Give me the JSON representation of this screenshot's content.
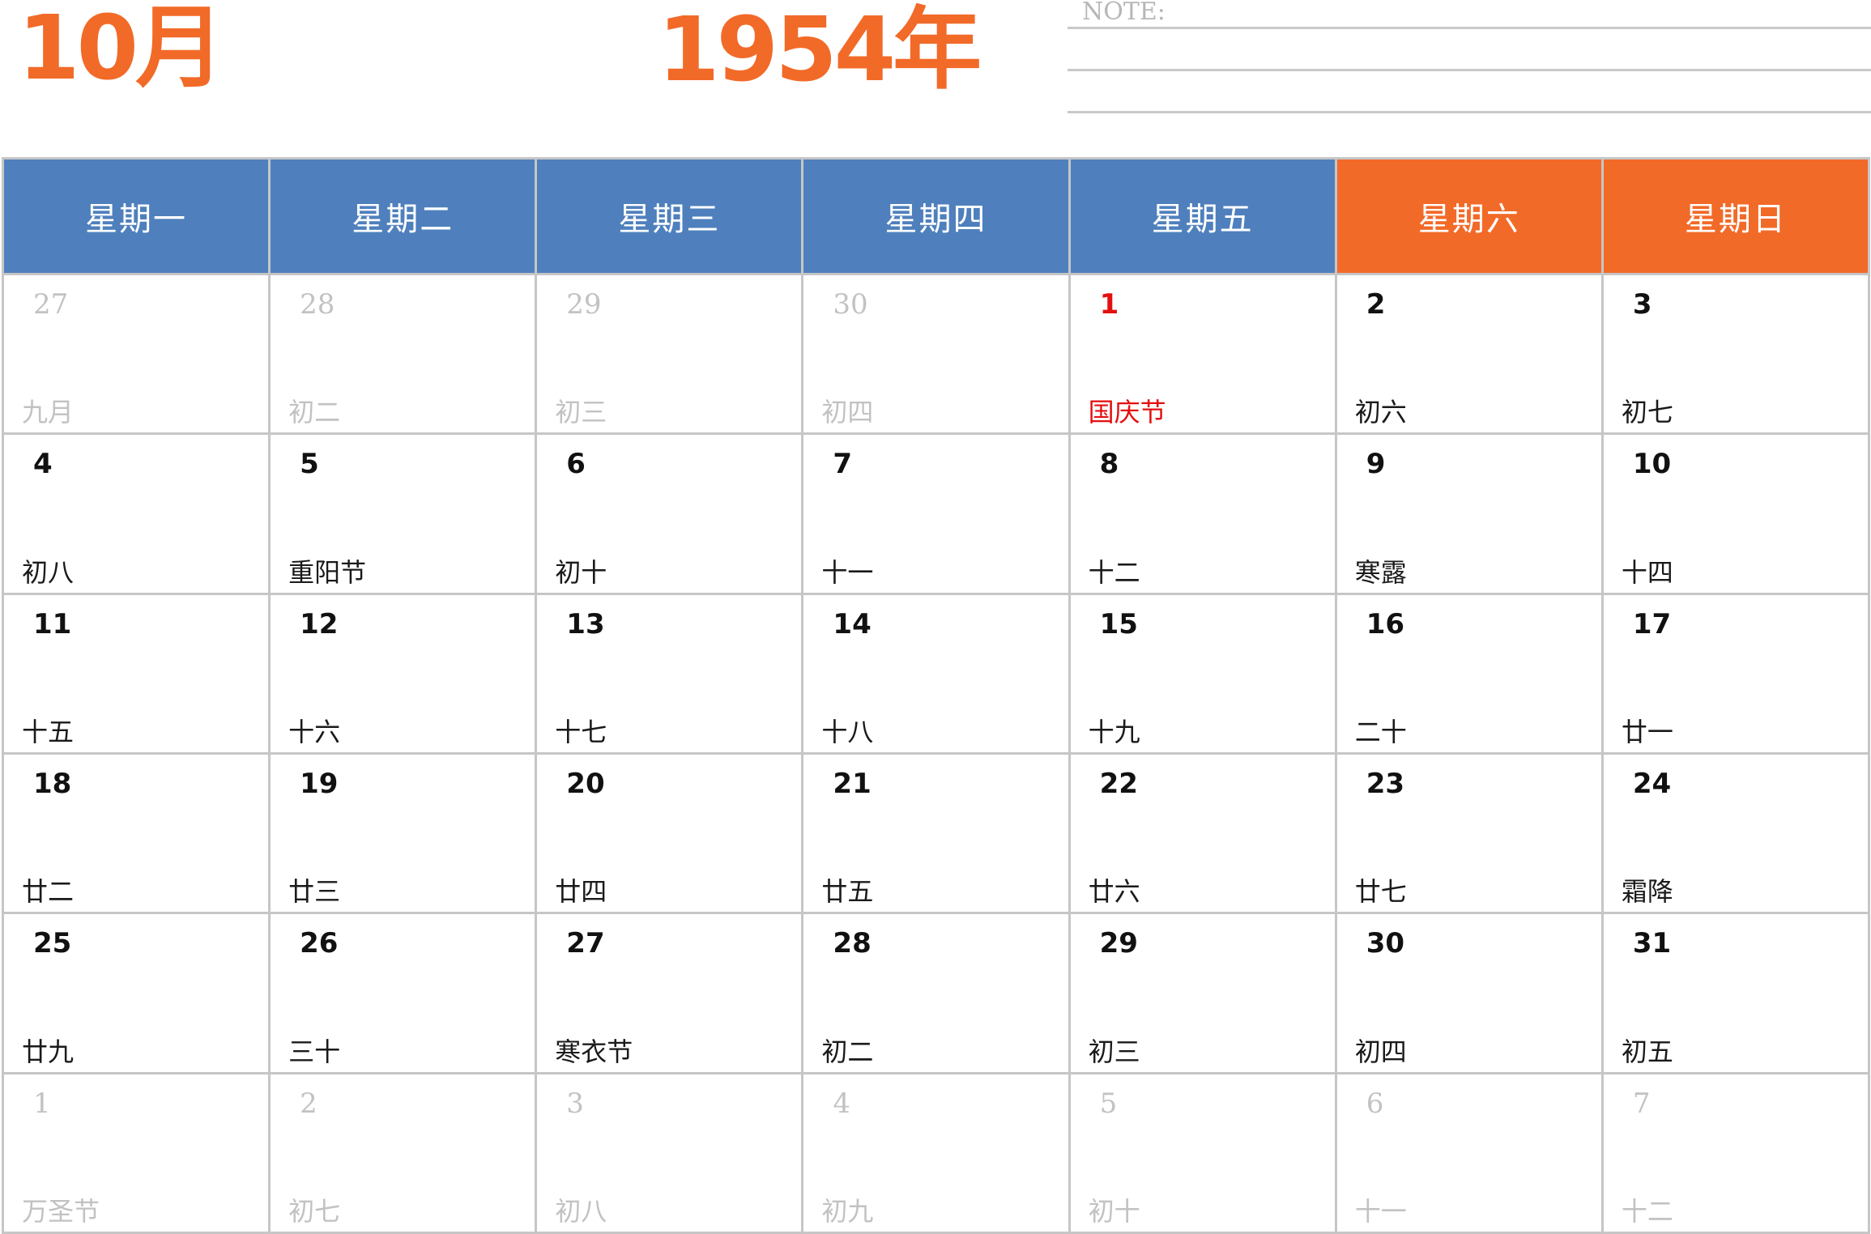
{
  "header": {
    "month": "10月",
    "year": "1954年",
    "note_label": "NOTE:"
  },
  "colors": {
    "accent": "#f26a28",
    "weekday_header": "#4f80bd",
    "holiday": "#e40f0f",
    "muted": "#c2c2c2"
  },
  "weekdays": [
    "星期一",
    "星期二",
    "星期三",
    "星期四",
    "星期五",
    "星期六",
    "星期日"
  ],
  "weeks": [
    [
      {
        "day": "27",
        "lunar": "九月",
        "muted": true
      },
      {
        "day": "28",
        "lunar": "初二",
        "muted": true
      },
      {
        "day": "29",
        "lunar": "初三",
        "muted": true
      },
      {
        "day": "30",
        "lunar": "初四",
        "muted": true
      },
      {
        "day": "1",
        "lunar": "国庆节",
        "holiday": true
      },
      {
        "day": "2",
        "lunar": "初六"
      },
      {
        "day": "3",
        "lunar": "初七"
      }
    ],
    [
      {
        "day": "4",
        "lunar": "初八"
      },
      {
        "day": "5",
        "lunar": "重阳节"
      },
      {
        "day": "6",
        "lunar": "初十"
      },
      {
        "day": "7",
        "lunar": "十一"
      },
      {
        "day": "8",
        "lunar": "十二"
      },
      {
        "day": "9",
        "lunar": "寒露"
      },
      {
        "day": "10",
        "lunar": "十四"
      }
    ],
    [
      {
        "day": "11",
        "lunar": "十五"
      },
      {
        "day": "12",
        "lunar": "十六"
      },
      {
        "day": "13",
        "lunar": "十七"
      },
      {
        "day": "14",
        "lunar": "十八"
      },
      {
        "day": "15",
        "lunar": "十九"
      },
      {
        "day": "16",
        "lunar": "二十"
      },
      {
        "day": "17",
        "lunar": "廿一"
      }
    ],
    [
      {
        "day": "18",
        "lunar": "廿二"
      },
      {
        "day": "19",
        "lunar": "廿三"
      },
      {
        "day": "20",
        "lunar": "廿四"
      },
      {
        "day": "21",
        "lunar": "廿五"
      },
      {
        "day": "22",
        "lunar": "廿六"
      },
      {
        "day": "23",
        "lunar": "廿七"
      },
      {
        "day": "24",
        "lunar": "霜降"
      }
    ],
    [
      {
        "day": "25",
        "lunar": "廿九"
      },
      {
        "day": "26",
        "lunar": "三十"
      },
      {
        "day": "27",
        "lunar": "寒衣节"
      },
      {
        "day": "28",
        "lunar": "初二"
      },
      {
        "day": "29",
        "lunar": "初三"
      },
      {
        "day": "30",
        "lunar": "初四"
      },
      {
        "day": "31",
        "lunar": "初五"
      }
    ],
    [
      {
        "day": "1",
        "lunar": "万圣节",
        "muted": true
      },
      {
        "day": "2",
        "lunar": "初七",
        "muted": true
      },
      {
        "day": "3",
        "lunar": "初八",
        "muted": true
      },
      {
        "day": "4",
        "lunar": "初九",
        "muted": true
      },
      {
        "day": "5",
        "lunar": "初十",
        "muted": true
      },
      {
        "day": "6",
        "lunar": "十一",
        "muted": true
      },
      {
        "day": "7",
        "lunar": "十二",
        "muted": true
      }
    ]
  ]
}
